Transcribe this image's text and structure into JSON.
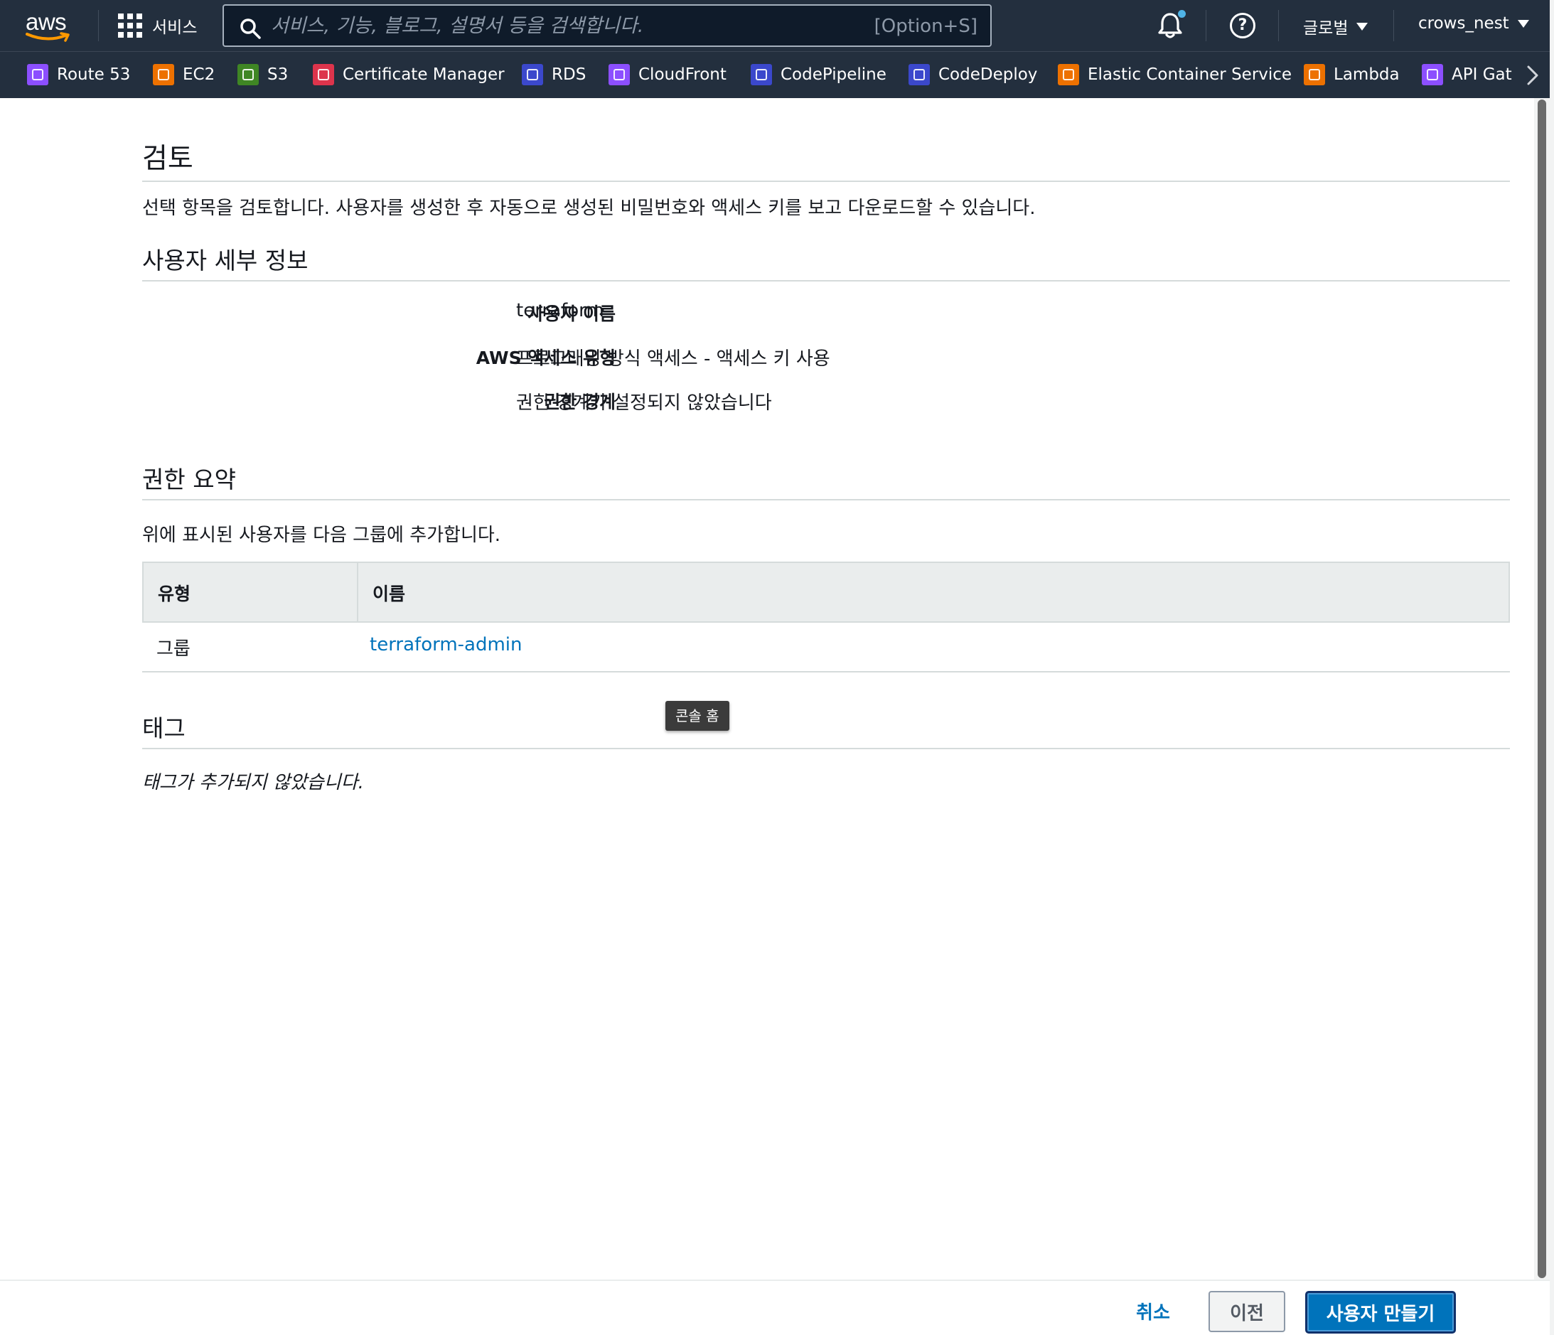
{
  "nav": {
    "logo": "aws",
    "services_label": "서비스",
    "search_placeholder": "서비스, 기능, 블로그, 설명서 등을 검색합니다.",
    "search_shortcut": "[Option+S]",
    "region": "글로벌",
    "account": "crows_nest"
  },
  "favorites": [
    {
      "label": "Route 53",
      "color": "#8c4fff"
    },
    {
      "label": "EC2",
      "color": "#ed7100"
    },
    {
      "label": "S3",
      "color": "#3f8624"
    },
    {
      "label": "Certificate Manager",
      "color": "#dd344c"
    },
    {
      "label": "RDS",
      "color": "#3b48cc"
    },
    {
      "label": "CloudFront",
      "color": "#8c4fff"
    },
    {
      "label": "CodePipeline",
      "color": "#3b48cc"
    },
    {
      "label": "CodeDeploy",
      "color": "#3b48cc"
    },
    {
      "label": "Elastic Container Service",
      "color": "#ed7100"
    },
    {
      "label": "Lambda",
      "color": "#ed7100"
    },
    {
      "label": "API Gat",
      "color": "#8c4fff"
    }
  ],
  "review": {
    "title": "검토",
    "description": "선택 항목을 검토합니다. 사용자를 생성한 후 자동으로 생성된 비밀번호와 액세스 키를 보고 다운로드할 수 있습니다."
  },
  "user_details": {
    "title": "사용자 세부 정보",
    "rows": [
      {
        "label": "사용자 이름",
        "value": "terraform"
      },
      {
        "label": "AWS 액세스 유형",
        "value": "프로그래밍 방식 액세스 - 액세스 키 사용"
      },
      {
        "label": "권한 경계",
        "value": "권한 경계가 설정되지 않았습니다"
      }
    ]
  },
  "permissions": {
    "title": "권한 요약",
    "description": "위에 표시된 사용자를 다음 그룹에 추가합니다.",
    "columns": [
      "유형",
      "이름"
    ],
    "rows": [
      {
        "type": "그룹",
        "name": "terraform-admin"
      }
    ]
  },
  "tags": {
    "title": "태그",
    "empty": "태그가 추가되지 않았습니다."
  },
  "tooltip": "콘솔 홈",
  "footer": {
    "cancel": "취소",
    "previous": "이전",
    "create": "사용자 만들기"
  },
  "colors": {
    "nav_bg": "#232f3e",
    "primary": "#0073bb",
    "link": "#0073bb"
  }
}
